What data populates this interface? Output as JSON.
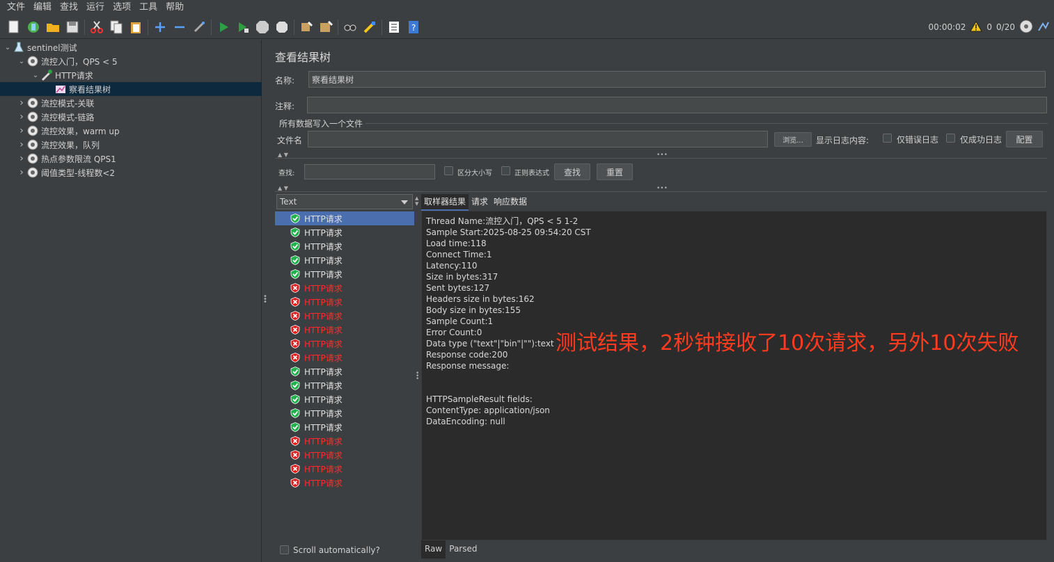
{
  "menu": [
    "文件",
    "编辑",
    "查找",
    "运行",
    "选项",
    "工具",
    "帮助"
  ],
  "toolbar": {
    "icons": [
      "new-icon",
      "templates-icon",
      "open-icon",
      "save-icon",
      "cut-icon",
      "copy-icon",
      "paste-icon",
      "expand-icon",
      "collapse-icon",
      "toggle-icon",
      "start-icon",
      "start-no-pause-icon",
      "stop-icon",
      "shutdown-icon",
      "clear-icon",
      "clear-all-icon",
      "search-icon",
      "reset-search-icon",
      "function-helper-icon",
      "help-icon"
    ],
    "timer": "00:00:02",
    "warning_count": "0",
    "threads": "0/20"
  },
  "tree": [
    {
      "label": "sentinel测试",
      "level": 0,
      "arrow": "down",
      "icon": "flask-icon"
    },
    {
      "label": "流控入门，QPS < 5",
      "level": 1,
      "arrow": "down",
      "icon": "gear-icon"
    },
    {
      "label": "HTTP请求",
      "level": 2,
      "arrow": "down",
      "icon": "pipette-icon"
    },
    {
      "label": "察看结果树",
      "level": 3,
      "arrow": "",
      "icon": "chart-icon",
      "selected": true
    },
    {
      "label": "流控模式-关联",
      "level": 1,
      "arrow": "right",
      "icon": "gear-icon"
    },
    {
      "label": "流控模式-链路",
      "level": 1,
      "arrow": "right",
      "icon": "gear-icon"
    },
    {
      "label": "流控效果，warm up",
      "level": 1,
      "arrow": "right",
      "icon": "gear-icon"
    },
    {
      "label": "流控效果，队列",
      "level": 1,
      "arrow": "right",
      "icon": "gear-icon"
    },
    {
      "label": "热点参数限流 QPS1",
      "level": 1,
      "arrow": "right",
      "icon": "gear-icon"
    },
    {
      "label": "阈值类型-线程数<2",
      "level": 1,
      "arrow": "right",
      "icon": "gear-icon"
    }
  ],
  "panel": {
    "title": "查看结果树",
    "name_label": "名称:",
    "name_value": "察看结果树",
    "comment_label": "注释:",
    "comment_value": "",
    "file_section": "所有数据写入一个文件",
    "file_label": "文件名",
    "file_value": "",
    "browse": "浏览...",
    "log_label": "显示日志内容:",
    "errors_only": "仅错误日志",
    "success_only": "仅成功日志",
    "configure": "配置",
    "search_label": "查找:",
    "search_value": "",
    "case_sensitive": "区分大小写",
    "regex": "正则表达式",
    "find": "查找",
    "reset": "重置",
    "renderer": "Text",
    "scroll_auto": "Scroll automatically?"
  },
  "results": [
    {
      "label": "HTTP请求",
      "status": "ok"
    },
    {
      "label": "HTTP请求",
      "status": "ok"
    },
    {
      "label": "HTTP请求",
      "status": "ok"
    },
    {
      "label": "HTTP请求",
      "status": "ok"
    },
    {
      "label": "HTTP请求",
      "status": "ok"
    },
    {
      "label": "HTTP请求",
      "status": "fail"
    },
    {
      "label": "HTTP请求",
      "status": "fail"
    },
    {
      "label": "HTTP请求",
      "status": "fail"
    },
    {
      "label": "HTTP请求",
      "status": "fail"
    },
    {
      "label": "HTTP请求",
      "status": "fail"
    },
    {
      "label": "HTTP请求",
      "status": "fail"
    },
    {
      "label": "HTTP请求",
      "status": "ok"
    },
    {
      "label": "HTTP请求",
      "status": "ok"
    },
    {
      "label": "HTTP请求",
      "status": "ok"
    },
    {
      "label": "HTTP请求",
      "status": "ok"
    },
    {
      "label": "HTTP请求",
      "status": "ok"
    },
    {
      "label": "HTTP请求",
      "status": "fail"
    },
    {
      "label": "HTTP请求",
      "status": "fail"
    },
    {
      "label": "HTTP请求",
      "status": "fail"
    },
    {
      "label": "HTTP请求",
      "status": "fail"
    }
  ],
  "detail_tabs": [
    "取样器结果",
    "请求",
    "响应数据"
  ],
  "detail_lines": [
    "Thread Name:流控入门，QPS < 5 1-2",
    "Sample Start:2025-08-25 09:54:20 CST",
    "Load time:118",
    "Connect Time:1",
    "Latency:110",
    "Size in bytes:317",
    "Sent bytes:127",
    "Headers size in bytes:162",
    "Body size in bytes:155",
    "Sample Count:1",
    "Error Count:0",
    "Data type (\"text\"|\"bin\"|\"\"):text",
    "Response code:200",
    "Response message:",
    "",
    "",
    "HTTPSampleResult fields:",
    "ContentType: application/json",
    "DataEncoding: null"
  ],
  "annotation": "测试结果，2秒钟接收了10次请求，另外10次失败",
  "bottom_tabs": [
    "Raw",
    "Parsed"
  ],
  "colors": {
    "ok": "#22b14c",
    "fail": "#e02020",
    "selection": "#4b6eaf"
  }
}
